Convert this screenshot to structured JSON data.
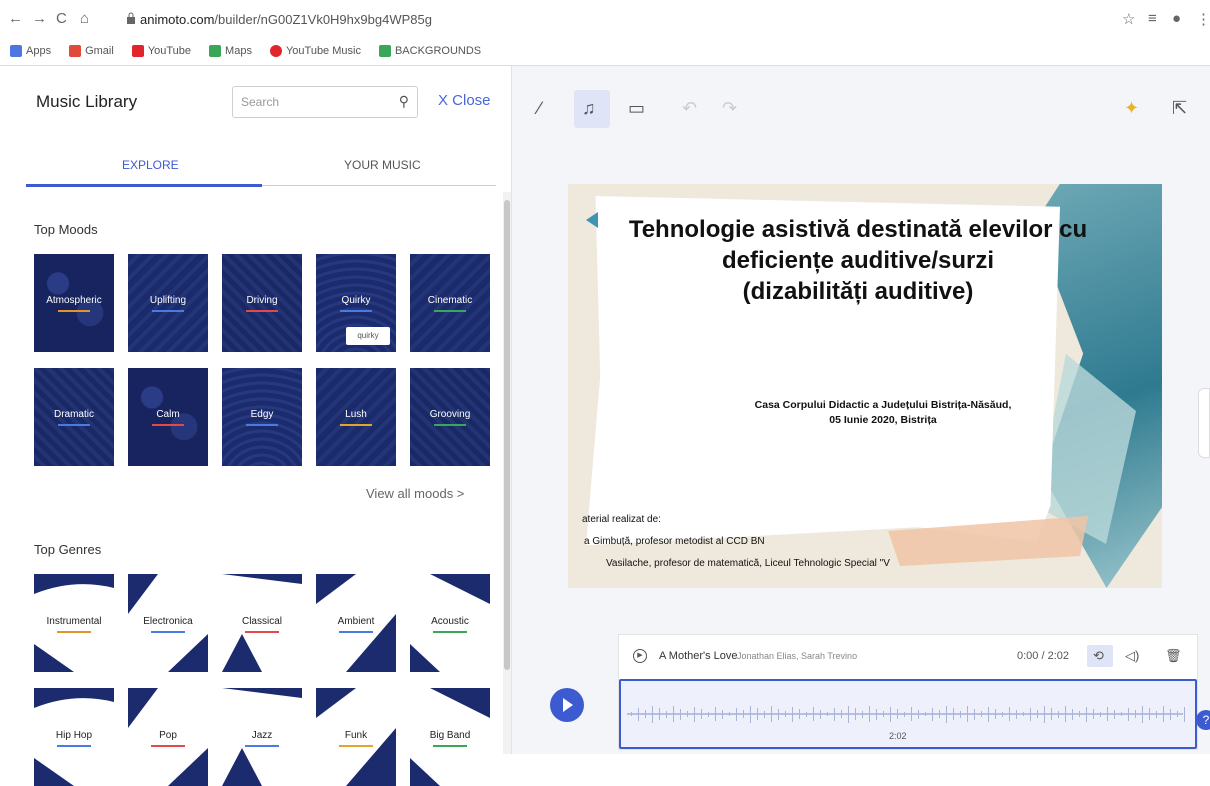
{
  "browser": {
    "url_host": "animoto.com",
    "url_path": "/builder/nG00Z1Vk0H9hx9bg4WP85g",
    "bookmarks": [
      {
        "label": "Apps",
        "color": "#4a78e0"
      },
      {
        "label": "Gmail",
        "color": "#e04a3a"
      },
      {
        "label": "YouTube",
        "color": "#e0262a"
      },
      {
        "label": "Maps",
        "color": "#3aa657"
      },
      {
        "label": "YouTube Music",
        "color": "#e0262a"
      },
      {
        "label": "BACKGROUNDS",
        "color": "#3aa657"
      }
    ]
  },
  "library": {
    "title": "Music Library",
    "search_placeholder": "Search",
    "close_label": "X Close",
    "tabs": [
      "EXPLORE",
      "YOUR MUSIC"
    ],
    "moods_heading": "Top Moods",
    "moods": [
      {
        "label": "Atmospheric",
        "bar": "#e0942a"
      },
      {
        "label": "Uplifting",
        "bar": "#4a7be0"
      },
      {
        "label": "Driving",
        "bar": "#e04a4a"
      },
      {
        "label": "Quirky",
        "bar": "#4a7be0",
        "tooltip": "quirky"
      },
      {
        "label": "Cinematic",
        "bar": "#3aa657"
      },
      {
        "label": "Dramatic",
        "bar": "#4a7be0"
      },
      {
        "label": "Calm",
        "bar": "#e04a4a"
      },
      {
        "label": "Edgy",
        "bar": "#4a7be0"
      },
      {
        "label": "Lush",
        "bar": "#e0a52a"
      },
      {
        "label": "Grooving",
        "bar": "#3aa657"
      }
    ],
    "view_all": "View all moods >",
    "genres_heading": "Top Genres",
    "genres": [
      {
        "label": "Instrumental",
        "bar": "#e0942a"
      },
      {
        "label": "Electronica",
        "bar": "#4a7be0"
      },
      {
        "label": "Classical",
        "bar": "#e04a4a"
      },
      {
        "label": "Ambient",
        "bar": "#4a7be0"
      },
      {
        "label": "Acoustic",
        "bar": "#3aa657"
      },
      {
        "label": "Hip Hop",
        "bar": "#4a7be0"
      },
      {
        "label": "Pop",
        "bar": "#e04a4a"
      },
      {
        "label": "Jazz",
        "bar": "#4a7be0"
      },
      {
        "label": "Funk",
        "bar": "#e0a52a"
      },
      {
        "label": "Big Band",
        "bar": "#3aa657"
      }
    ]
  },
  "slide": {
    "title_line1": "Tehnologie asistivă destinată elevilor cu",
    "title_line2": "deficiențe auditive/surzi",
    "title_line3": "(dizabilități auditive)",
    "sub_line1": "Casa Corpului Didactic a Județului Bistrița-Năsăud,",
    "sub_line2": "05 Iunie 2020, Bistrița",
    "credit1": "aterial realizat de:",
    "credit2": "a Gimbuță, profesor metodist al CCD BN",
    "credit3": "Vasilache, profesor de matematică, Liceul Tehnologic Special \"V"
  },
  "track": {
    "name": "A Mother's Love",
    "artists": "Jonathan Elias, Sarah Trevino",
    "time": "0:00 / 2:02",
    "duration_stamp": "2:02"
  },
  "accent": "#3d5bd1"
}
